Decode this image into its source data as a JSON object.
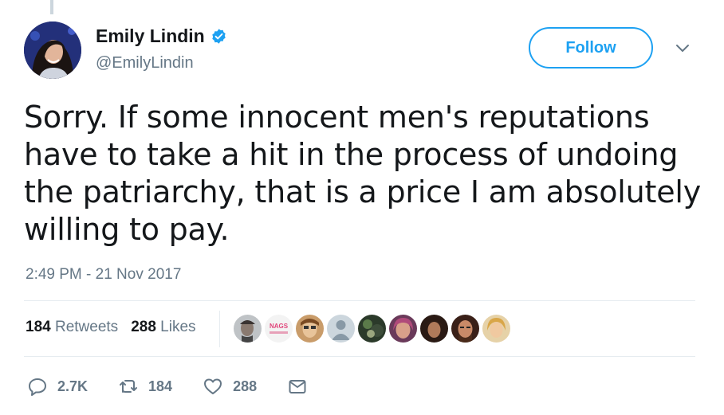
{
  "author": {
    "name": "Emily Lindin",
    "handle": "@EmilyLindin",
    "verified": true
  },
  "follow_label": "Follow",
  "tweet": {
    "text": "Sorry. If some innocent men's reputations have to take a hit in the process of undoing the patriarchy, that is a price I am absolutely willing to pay.",
    "timestamp": "2:49 PM - 21 Nov 2017"
  },
  "stats": {
    "retweets_count": "184",
    "retweets_label": "Retweets",
    "likes_count": "288",
    "likes_label": "Likes"
  },
  "likers_badge_text": "NAGS",
  "actions": {
    "reply_count": "2.7K",
    "retweet_count": "184",
    "like_count": "288"
  },
  "colors": {
    "accent": "#1da1f2",
    "secondary_text": "#657786",
    "primary_text": "#14171a",
    "divider": "#e6ecf0"
  }
}
